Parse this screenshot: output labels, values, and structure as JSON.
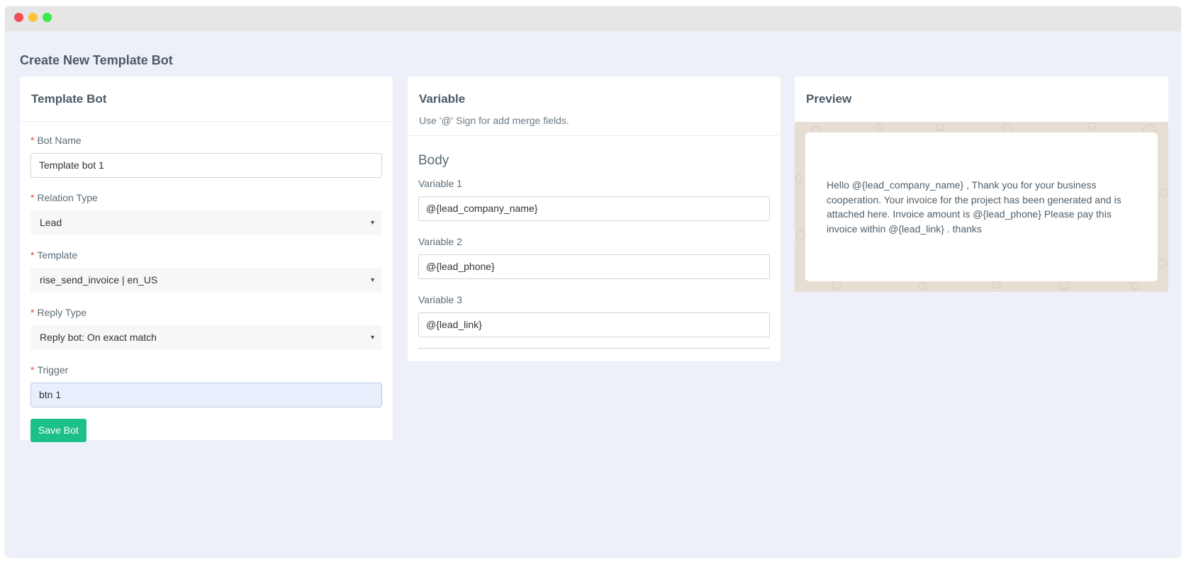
{
  "page": {
    "title": "Create New Template Bot"
  },
  "template_bot": {
    "title": "Template Bot",
    "bot_name": {
      "label": "Bot Name",
      "value": "Template bot 1"
    },
    "relation_type": {
      "label": "Relation Type",
      "value": "Lead"
    },
    "template": {
      "label": "Template",
      "value": "rise_send_invoice | en_US"
    },
    "reply_type": {
      "label": "Reply Type",
      "value": "Reply bot: On exact match"
    },
    "trigger": {
      "label": "Trigger",
      "value": "btn 1"
    },
    "required_mark": "*",
    "save_label": "Save Bot"
  },
  "variable": {
    "title": "Variable",
    "subtitle": "Use '@' Sign for add merge fields.",
    "section": "Body",
    "items": [
      {
        "label": "Variable 1",
        "value": "@{lead_company_name}"
      },
      {
        "label": "Variable 2",
        "value": "@{lead_phone}"
      },
      {
        "label": "Variable 3",
        "value": "@{lead_link}"
      }
    ]
  },
  "preview": {
    "title": "Preview",
    "message": "Hello @{lead_company_name} , Thank you for your business cooperation. Your invoice for the project has been generated and is attached here. Invoice amount is @{lead_phone} Please pay this invoice within @{lead_link} . thanks"
  },
  "icons": {
    "caret": "caret-down-icon"
  },
  "colors": {
    "accent": "#1dbf8b",
    "required": "#e0474c",
    "background": "#eef0f9",
    "preview_bg": "#e6ded3"
  }
}
